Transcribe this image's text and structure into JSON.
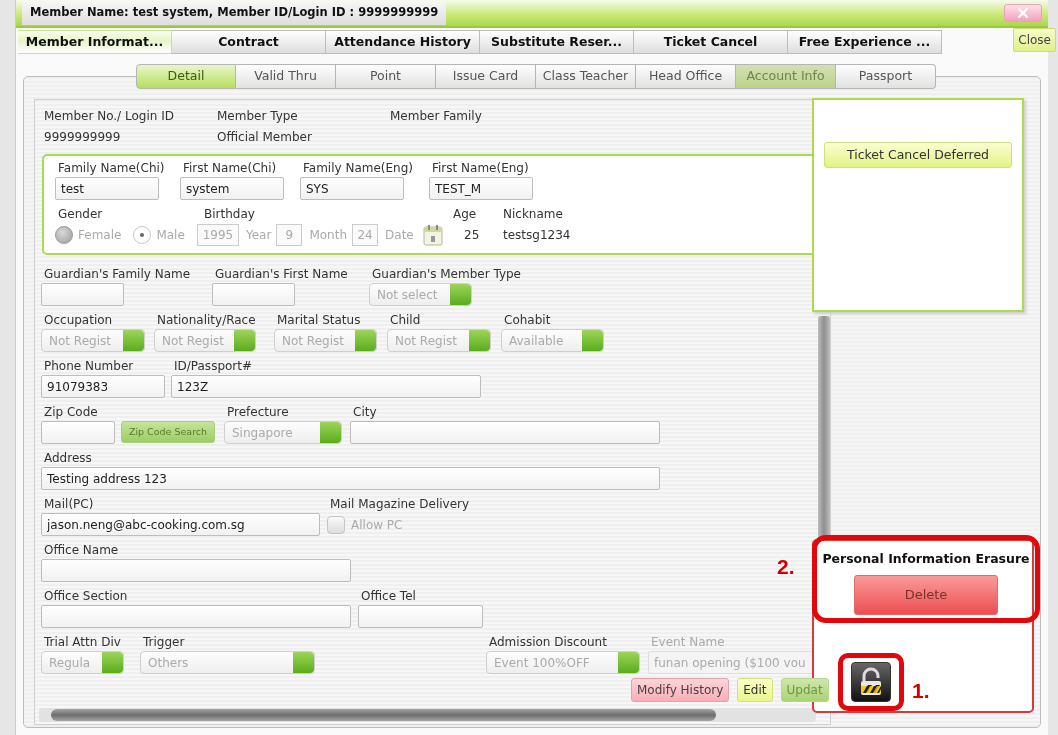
{
  "window": {
    "title": "Member Name: test system, Member ID/Login ID : 9999999999"
  },
  "tabs": [
    {
      "label": "Member Informat...",
      "selected": true
    },
    {
      "label": "Contract",
      "selected": false
    },
    {
      "label": "Attendance History",
      "selected": false
    },
    {
      "label": "Substitute Reser...",
      "selected": false
    },
    {
      "label": "Ticket Cancel",
      "selected": false
    },
    {
      "label": "Free Experience ...",
      "selected": false
    }
  ],
  "close_button": "Close",
  "subtabs": [
    {
      "label": "Detail",
      "selected": true,
      "disabled": false
    },
    {
      "label": "Valid Thru",
      "selected": false,
      "disabled": false
    },
    {
      "label": "Point",
      "selected": false,
      "disabled": false
    },
    {
      "label": "Issue Card",
      "selected": false,
      "disabled": false
    },
    {
      "label": "Class Teacher",
      "selected": false,
      "disabled": false
    },
    {
      "label": "Head Office",
      "selected": false,
      "disabled": false
    },
    {
      "label": "Account Info",
      "selected": false,
      "disabled": true
    },
    {
      "label": "Passport",
      "selected": false,
      "disabled": false
    }
  ],
  "member_summary": [
    {
      "label": "Member No./ Login ID",
      "value": "9999999999"
    },
    {
      "label": "Member Type",
      "value": "Official Member"
    },
    {
      "label": "Member Family"
    }
  ],
  "name_box": {
    "names": [
      {
        "label": "Family Name(Chi)",
        "value": "test"
      },
      {
        "label": "First Name(Chi)",
        "value": "system"
      },
      {
        "label": "Family Name(Eng)",
        "value": "SYS"
      },
      {
        "label": "First Name(Eng)",
        "value": "TEST_M"
      }
    ],
    "gender": {
      "label": "Gender",
      "options": [
        {
          "label": "Female",
          "selected": false
        },
        {
          "label": "Male",
          "selected": true
        }
      ]
    },
    "birthday": {
      "label": "Birthday",
      "parts": [
        {
          "value": "1995",
          "unit": "Year"
        },
        {
          "value": "9",
          "unit": "Month"
        },
        {
          "value": "24",
          "unit": "Date"
        }
      ]
    },
    "age": {
      "label": "Age",
      "value": "25"
    },
    "nickname": {
      "label": "Nickname",
      "value": "testsg1234"
    }
  },
  "form_rows": [
    [
      {
        "kind": "text",
        "label": "Guardian's Family Name"
      },
      {
        "kind": "text",
        "label": "Guardian's First Name"
      },
      {
        "kind": "select",
        "label": "Guardian's Member Type",
        "value": "Not select",
        "disabled": true
      }
    ],
    [
      {
        "kind": "select",
        "label": "Occupation",
        "value": "Not Regist",
        "disabled": true
      },
      {
        "kind": "select",
        "label": "Nationality/Race",
        "value": "Not Regist",
        "disabled": true
      },
      {
        "kind": "select",
        "label": "Marital Status",
        "value": "Not Regist",
        "disabled": true
      },
      {
        "kind": "select",
        "label": "Child",
        "value": "Not Regist",
        "disabled": true
      },
      {
        "kind": "select",
        "label": "Cohabit",
        "value": "Available",
        "disabled": true
      }
    ],
    [
      {
        "kind": "text",
        "label": "Phone Number",
        "value": "91079383"
      },
      {
        "kind": "text",
        "label": "ID/Passport#",
        "value": "123Z"
      }
    ],
    [
      {
        "kind": "text",
        "label": "Zip Code"
      },
      {
        "kind": "button",
        "value": "Zip Code Search",
        "disabled": true
      },
      {
        "kind": "select",
        "label": "Prefecture",
        "value": "Singapore",
        "disabled": true
      },
      {
        "kind": "text",
        "label": "City"
      }
    ],
    [
      {
        "kind": "text",
        "label": "Address",
        "value": "Testing address 123"
      }
    ],
    [
      {
        "kind": "text",
        "label": "Mail(PC)",
        "value": "jason.neng@abc-cooking.com.sg"
      },
      {
        "kind": "checkbox",
        "label": "Mail Magazine Delivery",
        "value": "Allow PC",
        "checked": false,
        "disabled": true
      }
    ],
    [
      {
        "kind": "text",
        "label": "Office Name"
      }
    ],
    [
      {
        "kind": "text",
        "label": "Office Section"
      },
      {
        "kind": "text",
        "label": "Office Tel"
      }
    ],
    [
      {
        "kind": "select",
        "label": "Trial Attn Div",
        "value": "Regula",
        "disabled": true
      },
      {
        "kind": "select",
        "label": "Trigger",
        "value": "Others",
        "disabled": true
      },
      {
        "kind": "select",
        "label": "Admission Discount",
        "value": "Event 100%OFF",
        "disabled": true
      },
      {
        "kind": "text",
        "label": "Event Name",
        "value": "funan opening ($100 vou",
        "disabled": true
      }
    ]
  ],
  "action_buttons": [
    {
      "label": "Modify History",
      "kind": "history",
      "disabled": false
    },
    {
      "label": "Edit",
      "kind": "edit",
      "disabled": false
    },
    {
      "label": "Updat",
      "kind": "update",
      "disabled": true
    }
  ],
  "side_panel": {
    "button": "Ticket Cancel Deferred"
  },
  "erasure": {
    "title": "Personal Information Erasure",
    "button": "Delete"
  },
  "annotations": [
    {
      "label": "2."
    },
    {
      "label": "1."
    }
  ]
}
